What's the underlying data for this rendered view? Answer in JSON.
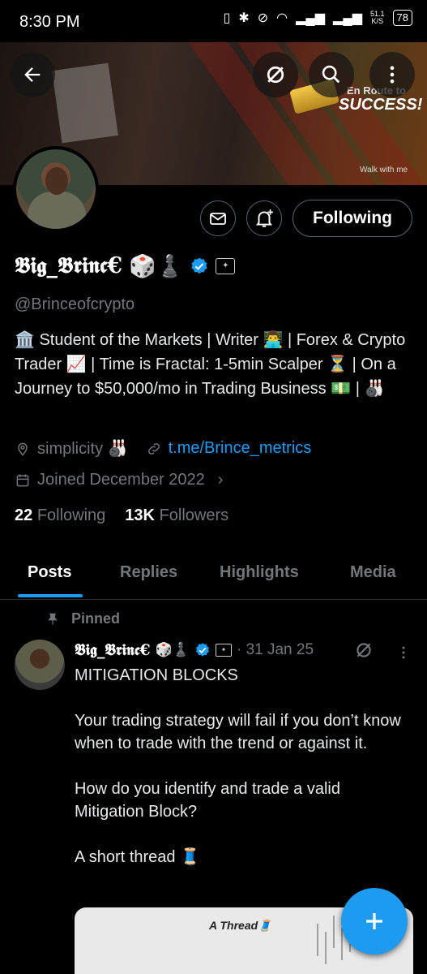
{
  "status_bar": {
    "time": "8:30 PM",
    "network_speed": "51.1\nK/S",
    "battery": "78"
  },
  "banner": {
    "line1": "En Route to",
    "line2": "SUCCESS!",
    "tagline": "Walk with me"
  },
  "header": {
    "back_icon": "arrow-left-icon",
    "grok_icon": "grok-icon",
    "search_icon": "search-icon",
    "more_icon": "more-vertical-icon"
  },
  "profile": {
    "following_button": "Following",
    "display_name": "𝕭𝖎𝖌_𝕭𝖗𝖎𝖓𝖈€",
    "name_emojis": "🎲♟️",
    "handle": "@Brinceofcrypto",
    "bio": "🏛️ Student of the Markets | Writer 👨‍💻 | Forex & Crypto Trader 📈 | Time is Fractal: 1-5min Scalper ⏳ | On a Journey to $50,000/mo in Trading Business 💵 | 🎳",
    "location": "simplicity 🎳",
    "website": "t.me/Brince_metrics",
    "joined": "Joined December 2022",
    "following_count": "22",
    "following_label": "Following",
    "followers_count": "13K",
    "followers_label": "Followers",
    "accent": "#1d9bf0"
  },
  "tabs": [
    {
      "label": "Posts",
      "active": true
    },
    {
      "label": "Replies",
      "active": false
    },
    {
      "label": "Highlights",
      "active": false
    },
    {
      "label": "Media",
      "active": false
    }
  ],
  "post": {
    "pinned_label": "Pinned",
    "author": "𝕭𝖎𝖌_𝕭𝖗𝖎𝖓𝖈€",
    "author_emojis": "🎲♟️",
    "date": "· 31 Jan 25",
    "body": "MITIGATION BLOCKS\n\nYour trading strategy will fail if you don’t know when to trade with the trend or against it.\n\nHow do you identify and trade a valid Mitigation Block?\n\nA short thread 🧵",
    "card_title": "A Thread🧵"
  },
  "fab": {
    "icon": "plus-icon"
  }
}
